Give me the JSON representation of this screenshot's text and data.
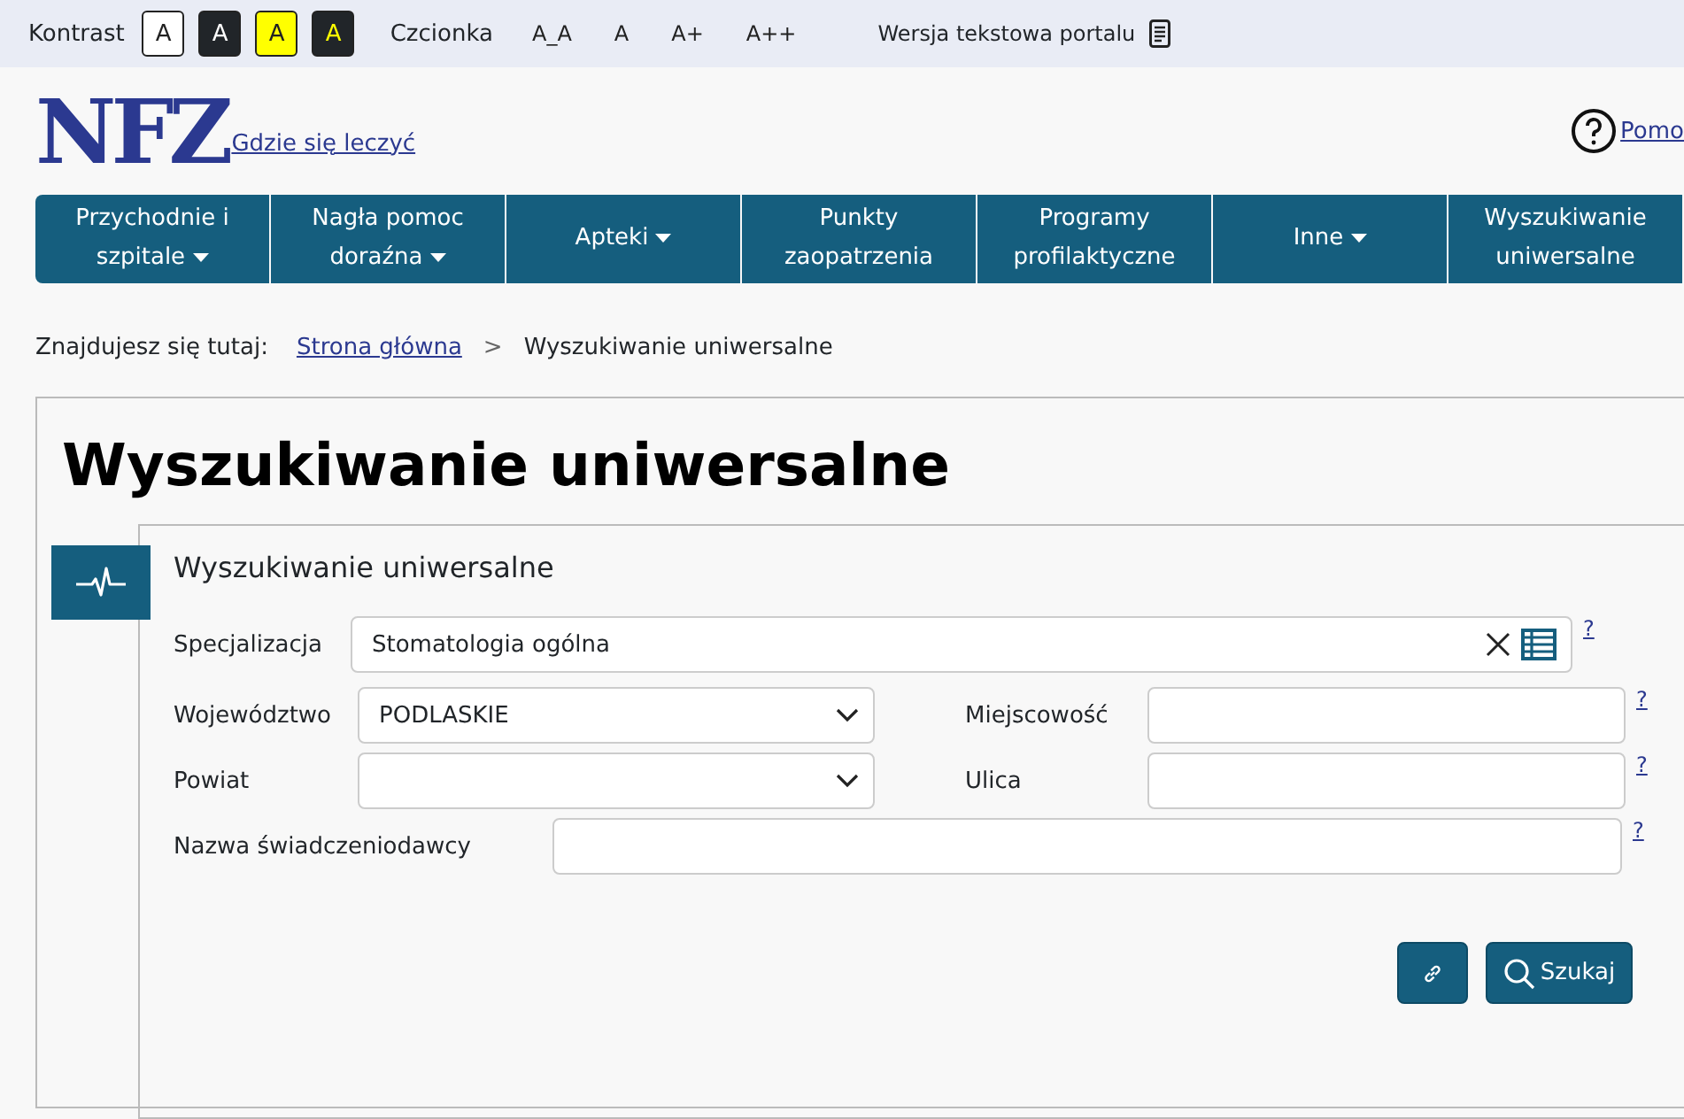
{
  "topbar": {
    "contrast_label": "Kontrast",
    "contrast_buttons": [
      {
        "label": "A",
        "kind": "white"
      },
      {
        "label": "A",
        "kind": "black"
      },
      {
        "label": "A",
        "kind": "yellow"
      },
      {
        "label": "A",
        "kind": "black-yellow"
      }
    ],
    "font_label": "Czcionka",
    "font_buttons": [
      "A_A",
      "A",
      "A+",
      "A++"
    ],
    "text_version": "Wersja tekstowa portalu"
  },
  "header": {
    "logo": "NFZ",
    "tagline": "Gdzie się leczyć",
    "help": "Pomo"
  },
  "nav": [
    {
      "label": "Przychodnie i szpitale",
      "dropdown": true
    },
    {
      "label": "Nagła pomoc doraźna",
      "dropdown": true
    },
    {
      "label": "Apteki",
      "dropdown": true
    },
    {
      "label": "Punkty zaopatrzenia",
      "dropdown": false
    },
    {
      "label": "Programy profilaktyczne",
      "dropdown": false
    },
    {
      "label": "Inne",
      "dropdown": true
    },
    {
      "label": "Wyszukiwanie uniwersalne",
      "dropdown": false
    }
  ],
  "breadcrumb": {
    "label": "Znajdujesz się tutaj:",
    "home": "Strona główna",
    "separator": ">",
    "current": "Wyszukiwanie uniwersalne"
  },
  "page_title": "Wyszukiwanie uniwersalne",
  "panel": {
    "title": "Wyszukiwanie uniwersalne",
    "specialization": {
      "label": "Specjalizacja",
      "value": "Stomatologia ogólna",
      "help": "?"
    },
    "left_fields": [
      {
        "label": "Województwo",
        "value": "PODLASKIE"
      },
      {
        "label": "Powiat"
      }
    ],
    "right_fields": [
      {
        "label": "Miejscowość",
        "help": "?"
      },
      {
        "label": "Ulica",
        "help": "?"
      }
    ],
    "provider": {
      "label": "Nazwa świadczeniodawcy",
      "help": "?"
    },
    "search_button": "Szukaj"
  }
}
